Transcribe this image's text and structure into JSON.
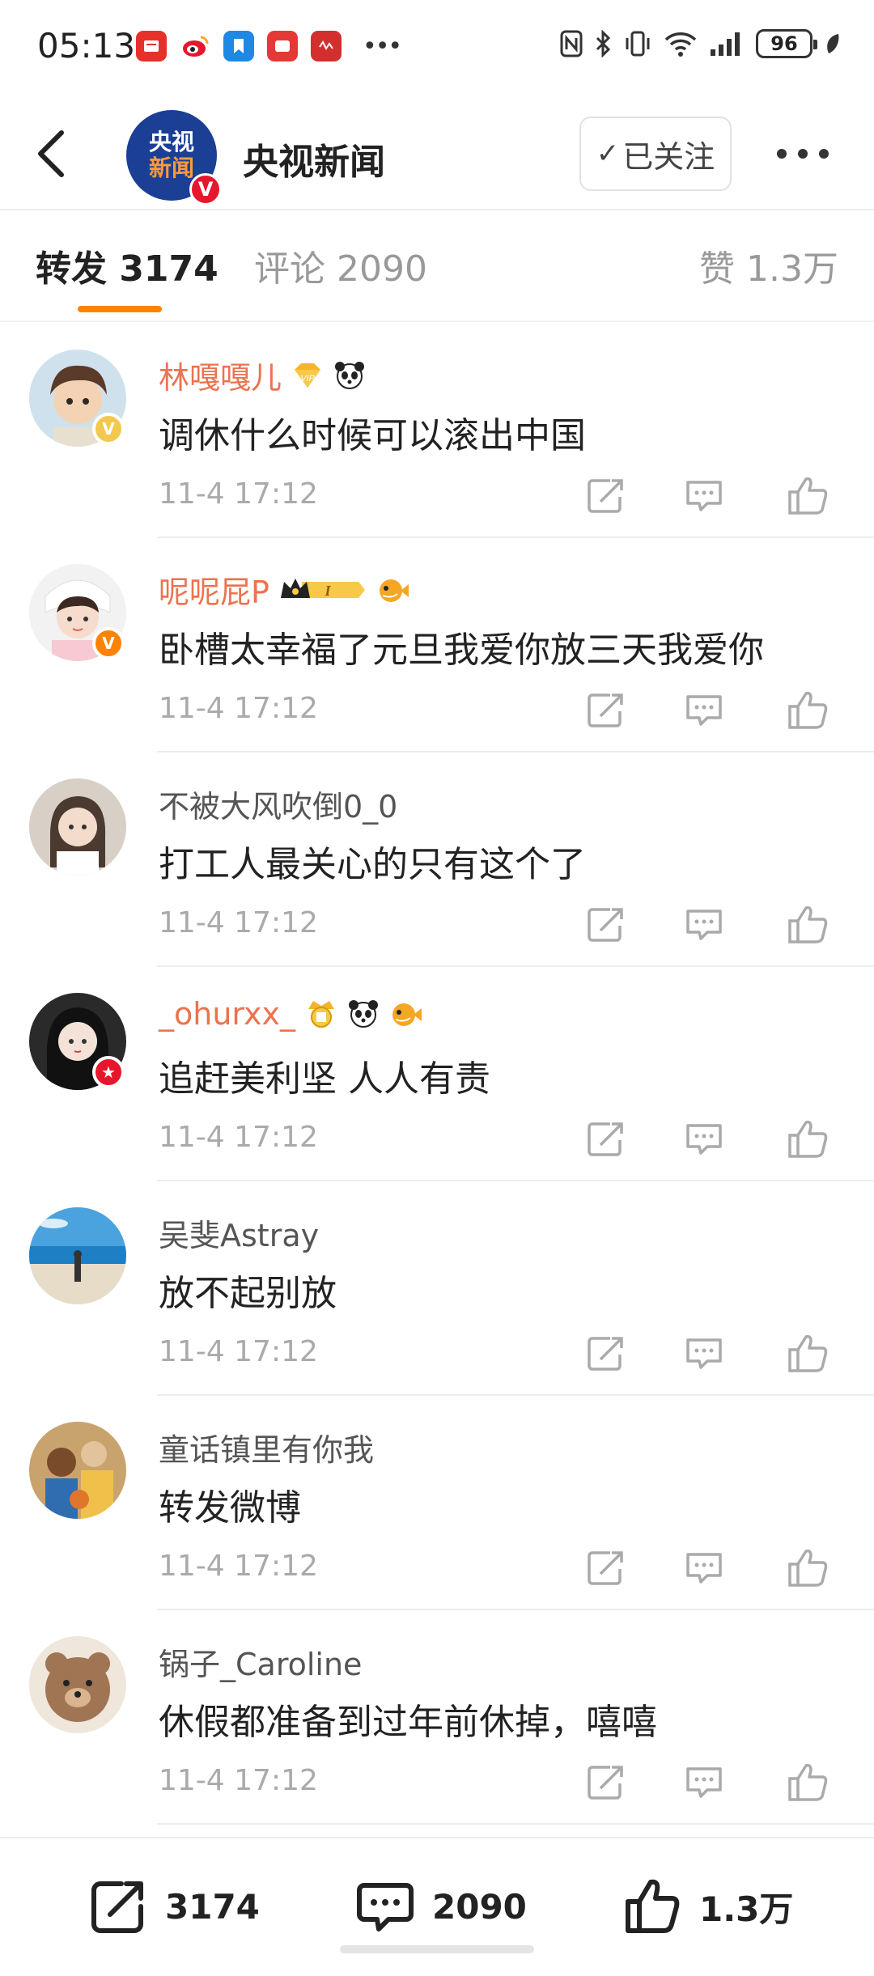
{
  "status_bar": {
    "time": "05:13",
    "battery": "96"
  },
  "header": {
    "account_name": "央视新闻",
    "avatar_line1": "央视",
    "avatar_line2": "新闻",
    "follow_label": "已关注"
  },
  "tabs": [
    {
      "label": "转发 3174"
    },
    {
      "label": "评论 2090"
    },
    {
      "label": "赞 1.3万"
    }
  ],
  "reposts": [
    {
      "user": "林嘎嘎儿",
      "text": "调休什么时候可以滚出中国",
      "time": "11-4 17:12",
      "name_color": "orange"
    },
    {
      "user": "呢呢屁P",
      "text": "卧槽太幸福了元旦我爱你放三天我爱你",
      "time": "11-4 17:12",
      "name_color": "orange"
    },
    {
      "user": "不被大风吹倒0_0",
      "text": "打工人最关心的只有这个了",
      "time": "11-4 17:12",
      "name_color": "gray"
    },
    {
      "user": "_ohurxx_",
      "text": "追赶美利坚 人人有责",
      "time": "11-4 17:12",
      "name_color": "orange"
    },
    {
      "user": "吴斐Astray",
      "text": "放不起别放",
      "time": "11-4 17:12",
      "name_color": "gray"
    },
    {
      "user": "童话镇里有你我",
      "text": "转发微博",
      "time": "11-4 17:12",
      "name_color": "gray"
    },
    {
      "user": "锅子_Caroline",
      "text": "休假都准备到过年前休掉，嘻嘻",
      "time": "11-4 17:12",
      "name_color": "gray"
    }
  ],
  "bottom_bar": {
    "repost_count": "3174",
    "comment_count": "2090",
    "like_count": "1.3万"
  },
  "colors": {
    "accent": "#ff8200",
    "vip_name": "#eb7350",
    "verified_red": "#e6162d"
  }
}
